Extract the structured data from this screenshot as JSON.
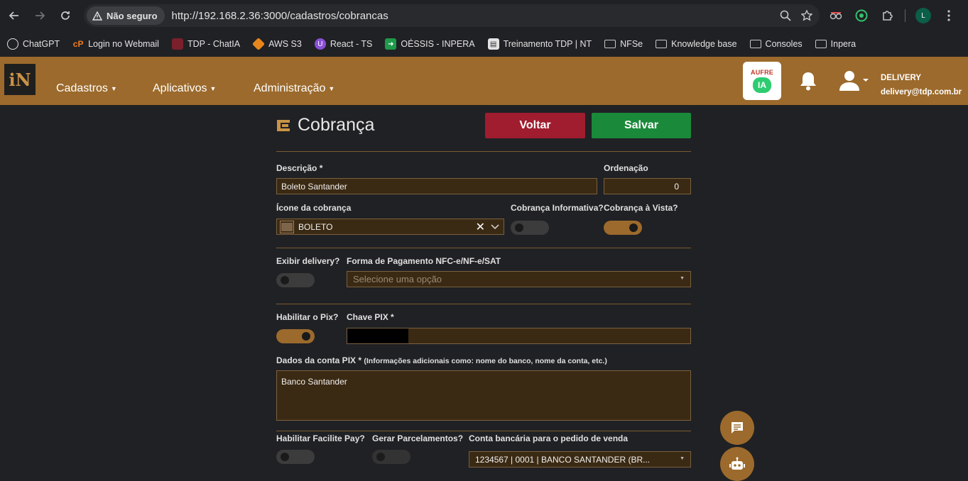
{
  "browser": {
    "security_label": "Não seguro",
    "url": "http://192.168.2.36:3000/cadastros/cobrancas",
    "profile_initial": "L"
  },
  "bookmarks": [
    {
      "label": "ChatGPT",
      "icon": "chatgpt-icon"
    },
    {
      "label": "Login no Webmail",
      "icon": "webmail-icon"
    },
    {
      "label": "TDP - ChatIA",
      "icon": "tdp-icon"
    },
    {
      "label": "AWS S3",
      "icon": "aws-icon"
    },
    {
      "label": "React - TS",
      "icon": "react-icon"
    },
    {
      "label": "OÉSSIS - INPERA",
      "icon": "oessis-icon"
    },
    {
      "label": "Treinamento TDP | NT",
      "icon": "training-icon"
    },
    {
      "label": "NFSe",
      "icon": "folder-icon"
    },
    {
      "label": "Knowledge base",
      "icon": "folder-icon"
    },
    {
      "label": "Consoles",
      "icon": "folder-icon"
    },
    {
      "label": "Inpera",
      "icon": "folder-icon"
    }
  ],
  "header": {
    "logo_text": "iN",
    "menu": {
      "cadastros": "Cadastros",
      "aplicativos": "Aplicativos",
      "administracao": "Administração"
    },
    "aufre_label": "AUFRE",
    "aufre_ia": "IA",
    "user_name": "DELIVERY",
    "user_email": "delivery@tdp.com.br"
  },
  "page": {
    "title": "Cobrança",
    "back_label": "Voltar",
    "save_label": "Salvar"
  },
  "form": {
    "descricao_label": "Descrição *",
    "descricao_value": "Boleto Santander",
    "ordenacao_label": "Ordenação",
    "ordenacao_value": "0",
    "icone_label": "Ícone da cobrança",
    "icone_value": "BOLETO",
    "informativa_label": "Cobrança Informativa?",
    "informativa_on": false,
    "vista_label": "Cobrança à Vista?",
    "vista_on": true,
    "exibir_delivery_label": "Exibir delivery?",
    "exibir_delivery_on": false,
    "forma_pagamento_label": "Forma de Pagamento NFC-e/NF-e/SAT",
    "forma_pagamento_placeholder": "Selecione uma opção",
    "pix_label": "Habilitar o Pix?",
    "pix_on": true,
    "chave_pix_label": "Chave PIX *",
    "dados_pix_label": "Dados da conta PIX *",
    "dados_pix_hint": "(Informações adicionais como: nome do banco, nome da conta, etc.)",
    "dados_pix_value": "Banco Santander",
    "facilite_label": "Habilitar Facilite Pay?",
    "facilite_on": false,
    "parcelamentos_label": "Gerar Parcelamentos?",
    "parcelamentos_on": false,
    "conta_bancaria_label": "Conta bancária para o pedido de venda",
    "conta_bancaria_value": "1234567 | 0001 | BANCO SANTANDER (BR..."
  },
  "colors": {
    "brand": "#9c6a2c",
    "back_button": "#a01c2f",
    "save_button": "#1a8a3a",
    "background": "#202124"
  }
}
